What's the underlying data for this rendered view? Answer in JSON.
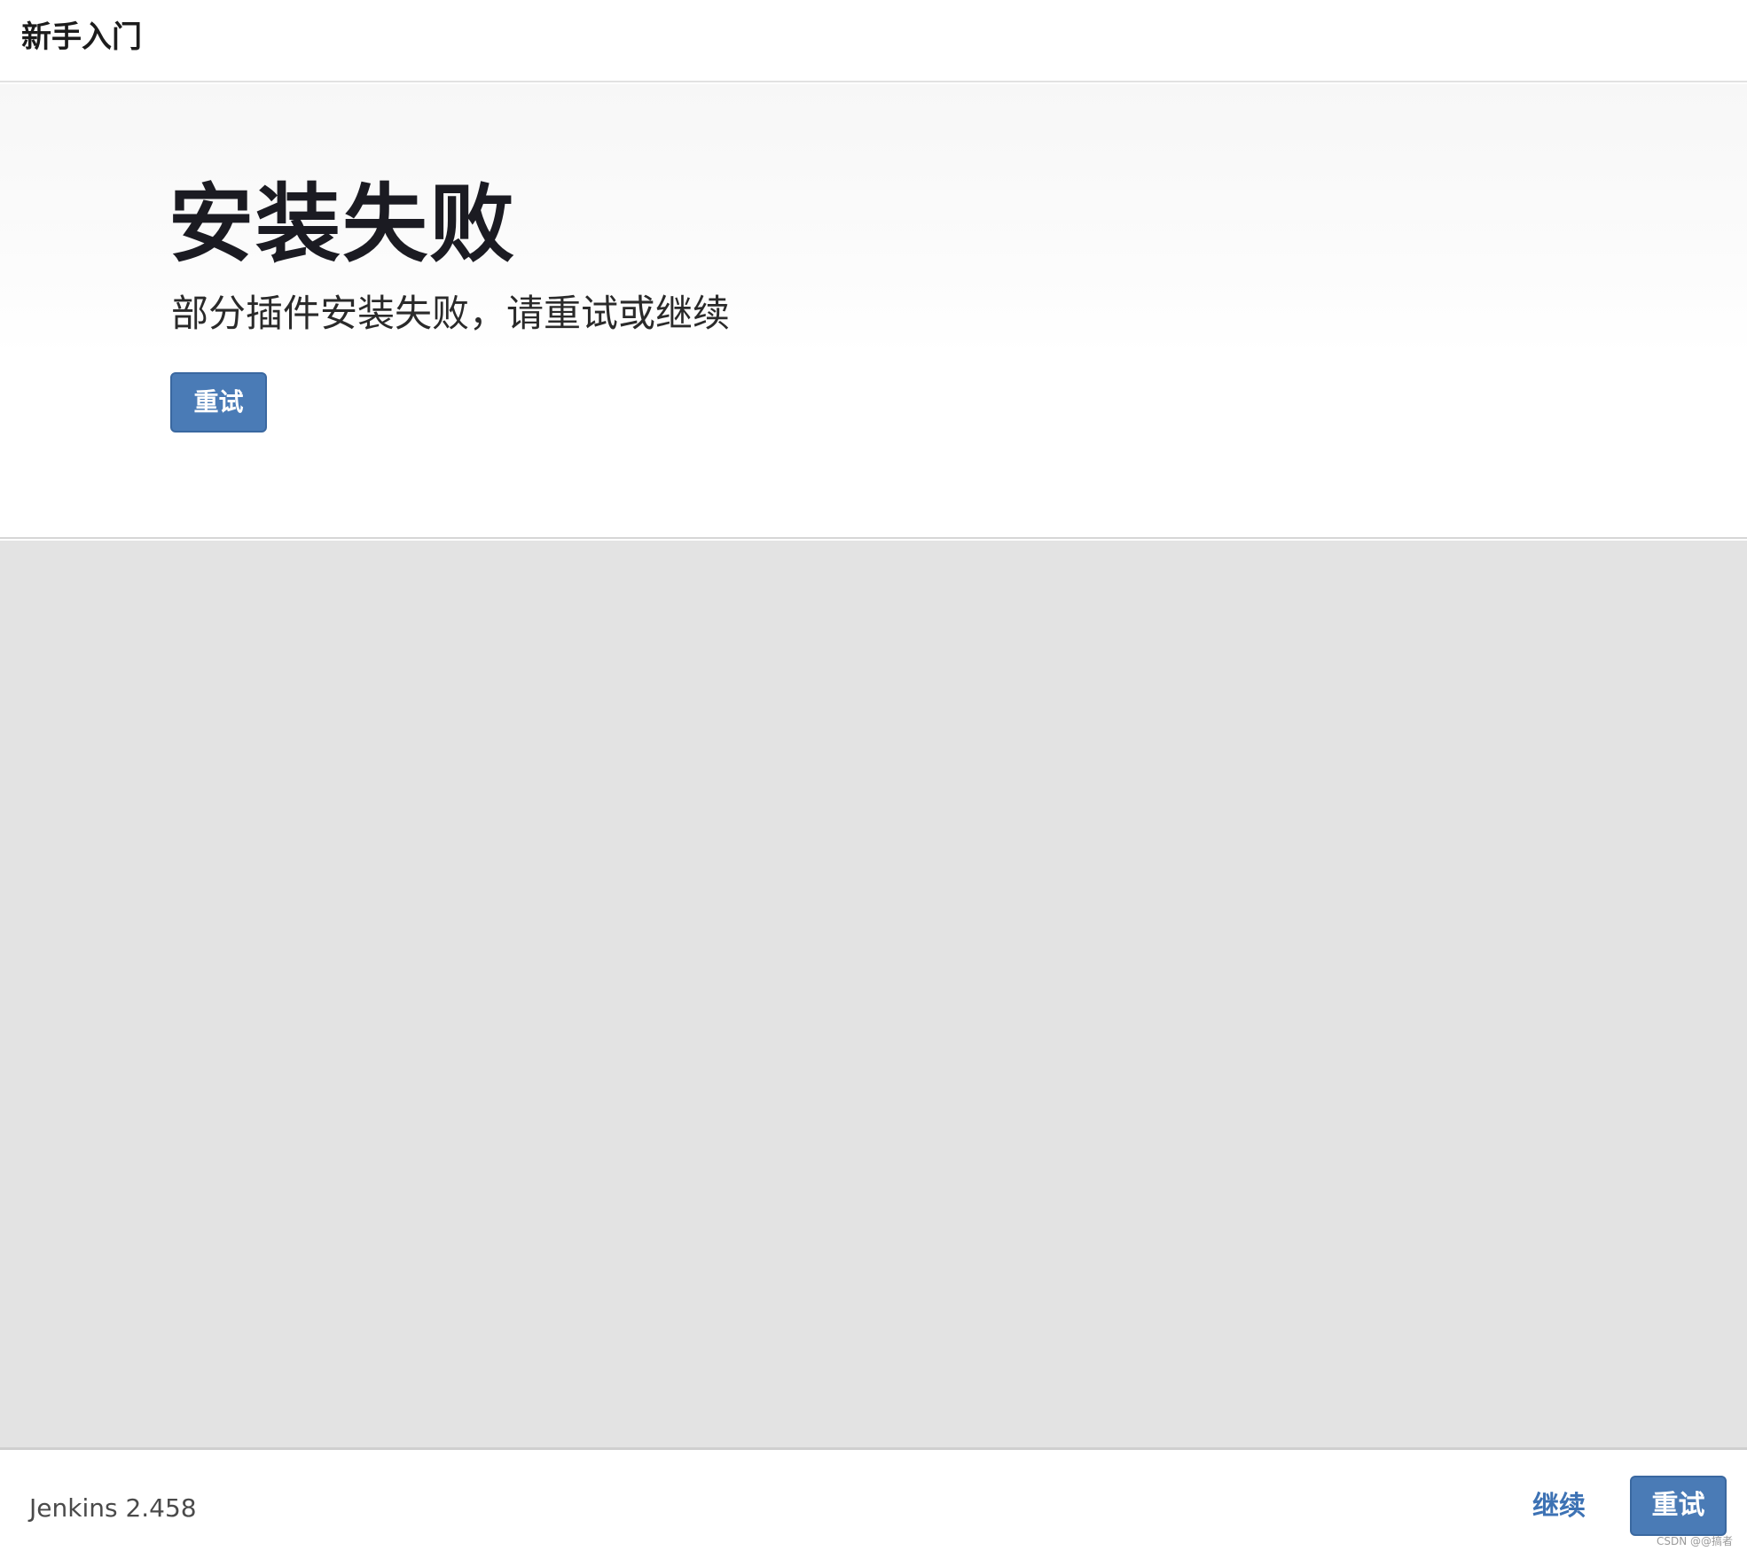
{
  "header": {
    "title": "新手入门"
  },
  "hero": {
    "title": "安装失败",
    "subtitle": "部分插件安装失败，请重试或继续",
    "retry_label": "重试"
  },
  "footer": {
    "version": "Jenkins 2.458",
    "continue_label": "继续",
    "retry_label": "重试"
  },
  "watermark": "CSDN @@搞者",
  "colors": {
    "primary_button": "#4a7bb6",
    "link": "#3d72b4",
    "content_background": "#e3e3e3"
  }
}
